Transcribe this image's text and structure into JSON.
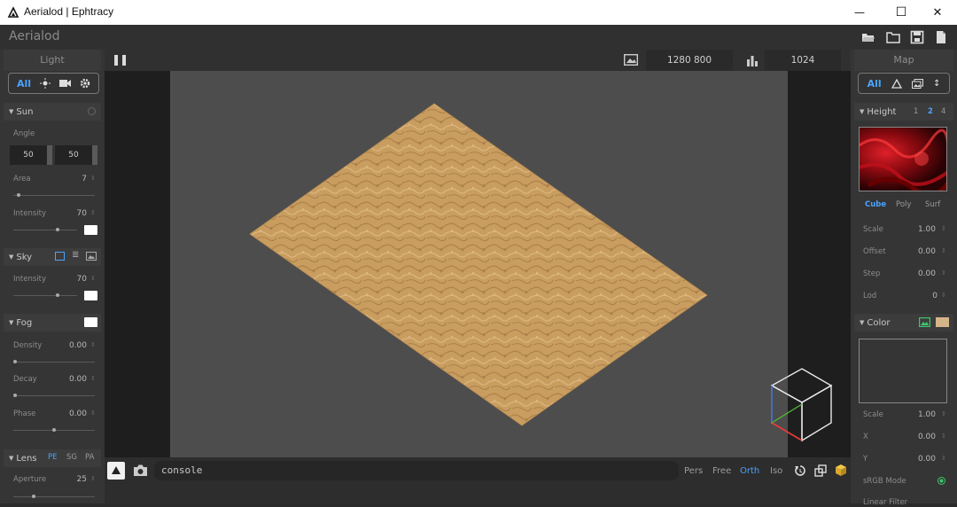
{
  "window": {
    "title": "Aerialod | Ephtracy",
    "minimize": "—",
    "maximize": "☐",
    "close": "✕"
  },
  "app": {
    "name": "Aerialod"
  },
  "toolbar": {
    "resolution": "1280  800",
    "sample_count": "1024"
  },
  "left": {
    "title": "Light",
    "filter_all": "All",
    "sun": {
      "label": "Sun",
      "angle_label": "Angle",
      "angle_a": "50",
      "angle_b": "50",
      "area_label": "Area",
      "area_value": "7",
      "area_level": 0.07,
      "intensity_label": "Intensity",
      "intensity_value": "70",
      "intensity_level": 0.7
    },
    "sky": {
      "label": "Sky",
      "intensity_label": "Intensity",
      "intensity_value": "70",
      "intensity_level": 0.7
    },
    "fog": {
      "label": "Fog",
      "density_label": "Density",
      "density_value": "0.00",
      "decay_label": "Decay",
      "decay_value": "0.00",
      "phase_label": "Phase",
      "phase_value": "0.00",
      "phase_level": 0.5
    },
    "lens": {
      "label": "Lens",
      "modes": [
        "PE",
        "SG",
        "PA"
      ],
      "aperture_label": "Aperture",
      "aperture_value": "25",
      "aperture_level": 0.25
    }
  },
  "right": {
    "title": "Map",
    "filter_all": "All",
    "height": {
      "label": "Height",
      "levels": [
        "1",
        "2",
        "4"
      ],
      "active_level": "2",
      "shapes": [
        "Cube",
        "Poly",
        "Surf"
      ],
      "active_shape": "Cube",
      "scale_label": "Scale",
      "scale_value": "1.00",
      "offset_label": "Offset",
      "offset_value": "0.00",
      "step_label": "Step",
      "step_value": "0.00",
      "lod_label": "Lod",
      "lod_value": "0"
    },
    "color": {
      "label": "Color",
      "scale_label": "Scale",
      "scale_value": "1.00",
      "x_label": "X",
      "x_value": "0.00",
      "y_label": "Y",
      "y_value": "0.00",
      "srgb_label": "sRGB Mode",
      "linear_label": "Linear Filter"
    }
  },
  "bottom": {
    "console": "console",
    "view_modes": [
      "Pers",
      "Free",
      "Orth",
      "Iso"
    ],
    "active_view": "Orth"
  },
  "colors": {
    "accent": "#4aa3ff",
    "terrain": "#c79a5a",
    "height_map": "#b0101a",
    "swatch": "#d4b489"
  }
}
